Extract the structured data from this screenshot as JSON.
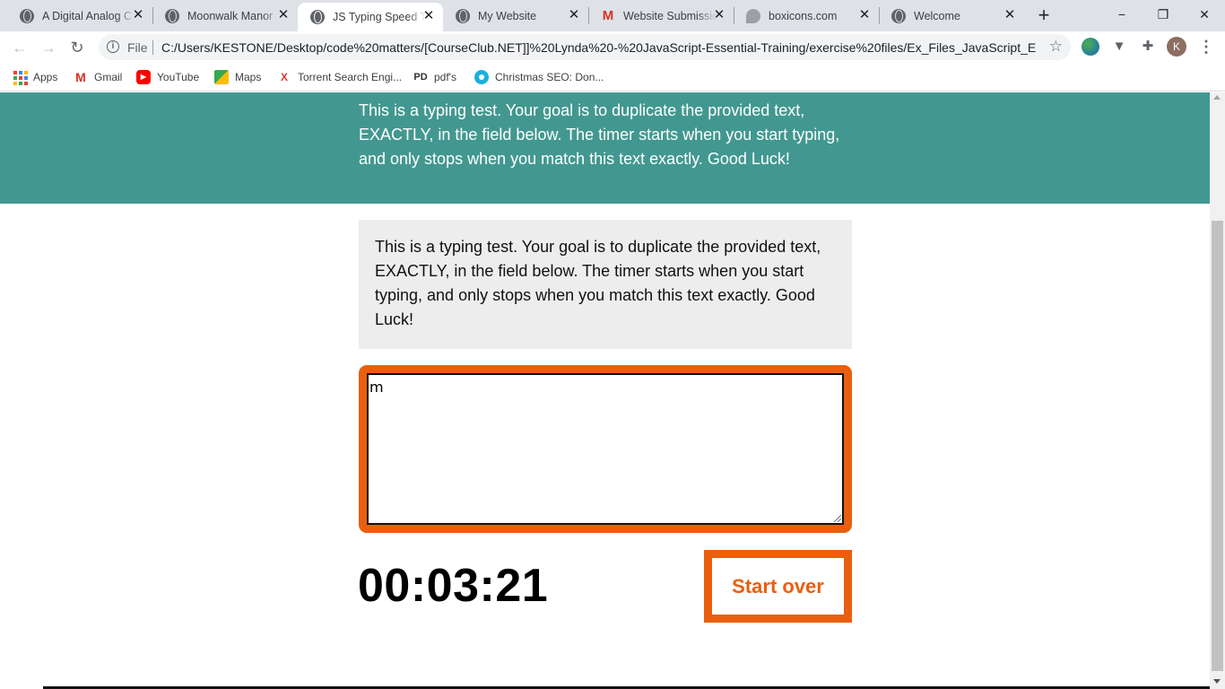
{
  "browser": {
    "tabs": [
      {
        "title": "A Digital Analog C",
        "favicon": "globe-icon"
      },
      {
        "title": "Moonwalk Manor",
        "favicon": "globe-icon"
      },
      {
        "title": "JS Typing Speed Te",
        "favicon": "globe-icon",
        "active": true
      },
      {
        "title": "My Website",
        "favicon": "globe-icon"
      },
      {
        "title": "Website Submissio",
        "favicon": "gmail-icon"
      },
      {
        "title": "boxicons.com",
        "favicon": "boxicons-icon"
      },
      {
        "title": "Welcome",
        "favicon": "globe-icon"
      }
    ],
    "new_tab_symbol": "+",
    "window_controls": {
      "minimize": "−",
      "maximize": "❐",
      "close": "✕"
    },
    "toolbar": {
      "back": "←",
      "forward": "→",
      "reload": "↻",
      "info": "i",
      "scheme_label": "File",
      "url": "C:/Users/KESTONE/Desktop/code%20matters/[CourseClub.NET]]%20Lynda%20-%20JavaScript-Essential-Training/exercise%20files/Ex_Files_JavaScript_EssT/E...",
      "bookmark_star": "☆",
      "extension_filter": "▼",
      "extension_puzzle": "✚",
      "profile_initial": "K",
      "menu": "⋮"
    },
    "bookmarks": [
      {
        "label": "Apps",
        "icon": "apps-grid-icon"
      },
      {
        "label": "Gmail",
        "icon": "gmail-icon",
        "glyph": "M"
      },
      {
        "label": "YouTube",
        "icon": "youtube-icon",
        "glyph": "▶"
      },
      {
        "label": "Maps",
        "icon": "maps-icon"
      },
      {
        "label": "Torrent Search Engi...",
        "icon": "torrent-icon",
        "glyph": "X"
      },
      {
        "label": "pdf's",
        "icon": "pdf-icon",
        "glyph": "PD"
      },
      {
        "label": "Christmas SEO: Don...",
        "icon": "christmas-seo-icon"
      }
    ],
    "colors": {
      "tabstrip": "#dee1e6",
      "accent_gmail": "#d93025"
    }
  },
  "page": {
    "intro": "This is a typing test. Your goal is to duplicate the provided text, EXACTLY, in the field below. The timer starts when you start typing, and only stops when you match this text exactly. Good Luck!",
    "origin_text": "This is a typing test. Your goal is to duplicate the provided text, EXACTLY, in the field below. The timer starts when you start typing, and only stops when you match this text exactly. Good Luck!",
    "typed_value": "m",
    "timer": "00:03:21",
    "reset_label": "Start over",
    "colors": {
      "header_bg": "#429890",
      "accent": "#e95f0e",
      "test_area_bg": "#ededed"
    }
  }
}
